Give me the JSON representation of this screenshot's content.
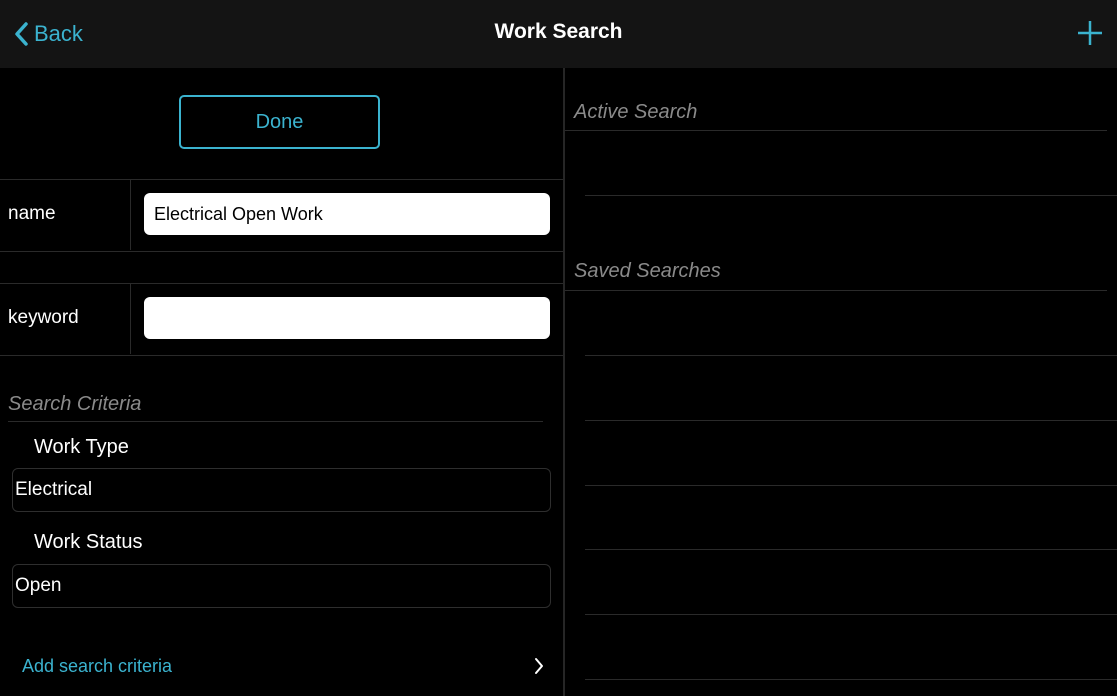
{
  "navbar": {
    "back_label": "Back",
    "title": "Work Search"
  },
  "left": {
    "done_label": "Done",
    "name_field": {
      "label": "name",
      "value": "Electrical Open Work"
    },
    "keyword_field": {
      "label": "keyword",
      "value": ""
    },
    "criteria_header": "Search Criteria",
    "criteria": [
      {
        "label": "Work Type",
        "value": "Electrical"
      },
      {
        "label": "Work Status",
        "value": "Open"
      }
    ],
    "add_criteria_label": "Add search criteria"
  },
  "right": {
    "active_header": "Active Search",
    "saved_header": "Saved Searches"
  },
  "colors": {
    "accent": "#3bb3cf",
    "background": "#000000",
    "navbar": "#141414",
    "separator": "#2a2a2a",
    "section_header": "#8a8a8a"
  },
  "icons": {
    "back": "chevron-left-icon",
    "add": "plus-icon",
    "disclosure": "chevron-right-icon"
  }
}
